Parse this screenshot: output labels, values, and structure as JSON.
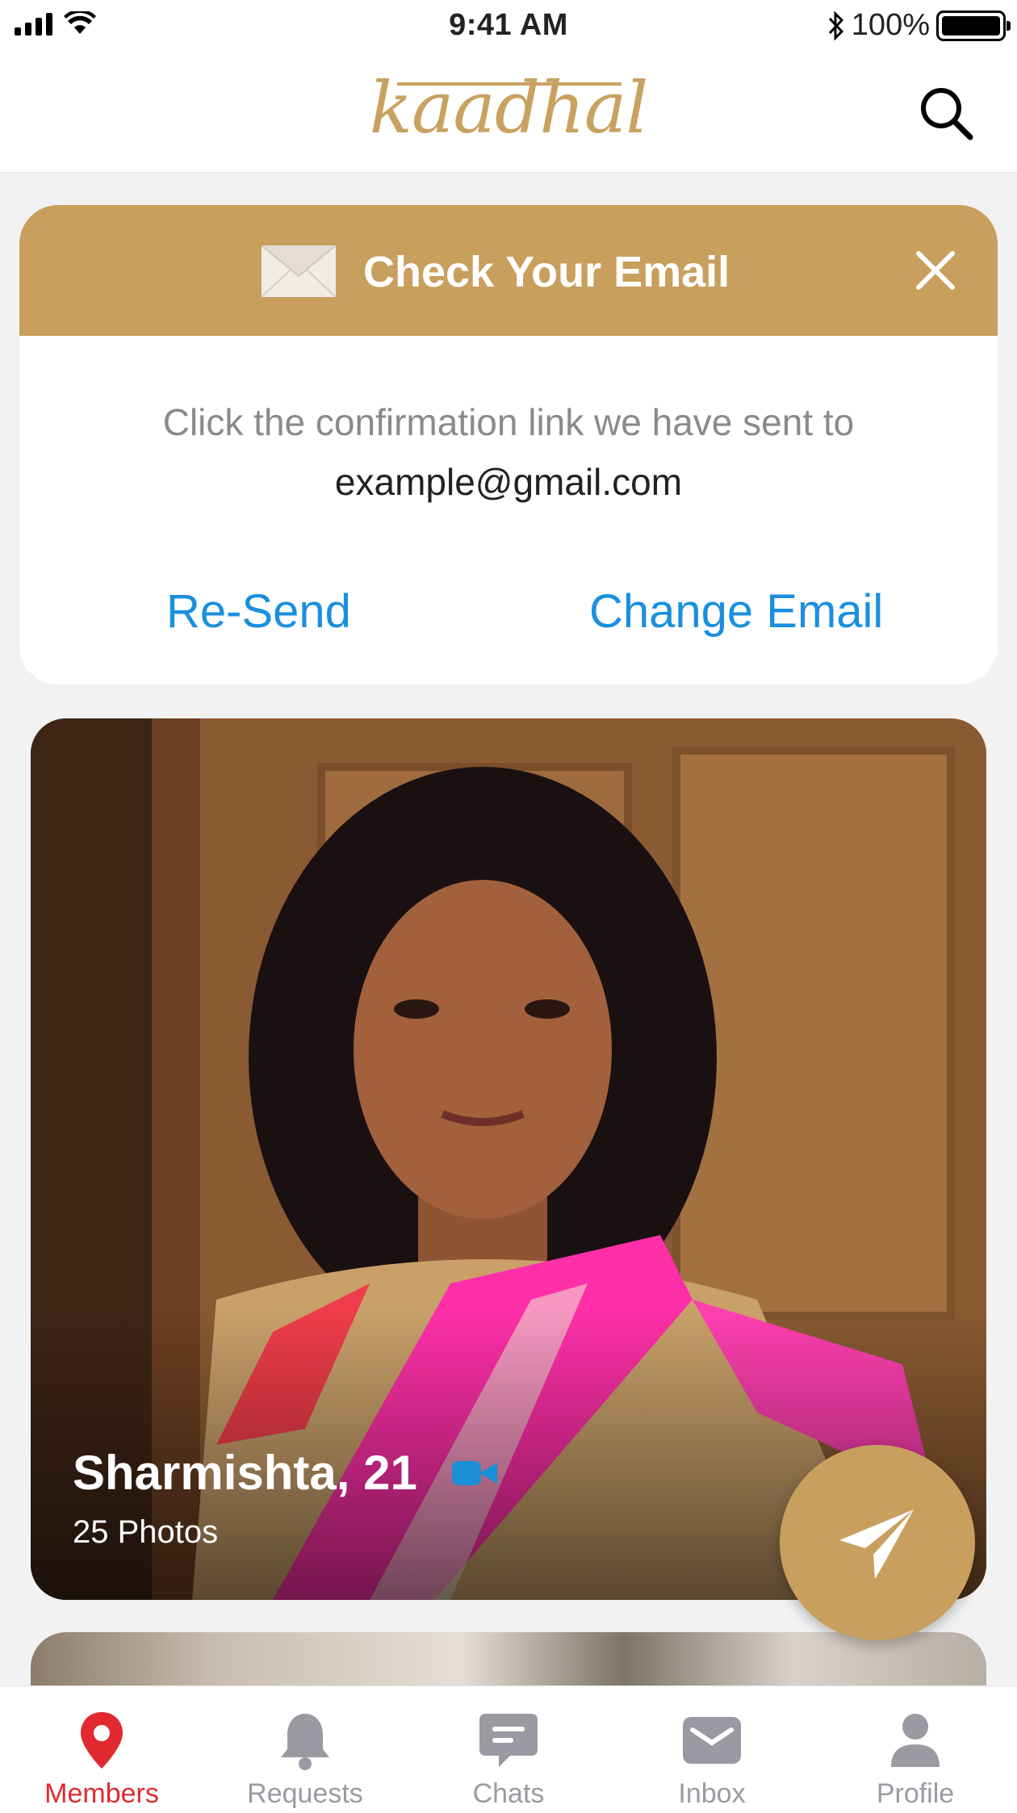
{
  "status_bar": {
    "time": "9:41 AM",
    "battery": "100%"
  },
  "header": {
    "logo_text": "kaadhal"
  },
  "email_card": {
    "title": "Check Your Email",
    "message": "Click the confirmation link we have sent to",
    "email": "example@gmail.com",
    "resend_label": "Re-Send",
    "change_email_label": "Change Email"
  },
  "profile": {
    "name_age": "Sharmishta, 21",
    "photos": "25 Photos"
  },
  "bottom_nav": {
    "items": [
      {
        "label": "Members",
        "icon": "location-pin-icon",
        "active": true
      },
      {
        "label": "Requests",
        "icon": "bell-icon",
        "active": false
      },
      {
        "label": "Chats",
        "icon": "chat-bubble-icon",
        "active": false
      },
      {
        "label": "Inbox",
        "icon": "envelope-icon",
        "active": false
      },
      {
        "label": "Profile",
        "icon": "person-icon",
        "active": false
      }
    ]
  },
  "colors": {
    "brand": "#c89f5d",
    "link": "#1a8fe0",
    "active": "#e02a2f",
    "inactive": "#9a9aa3"
  }
}
